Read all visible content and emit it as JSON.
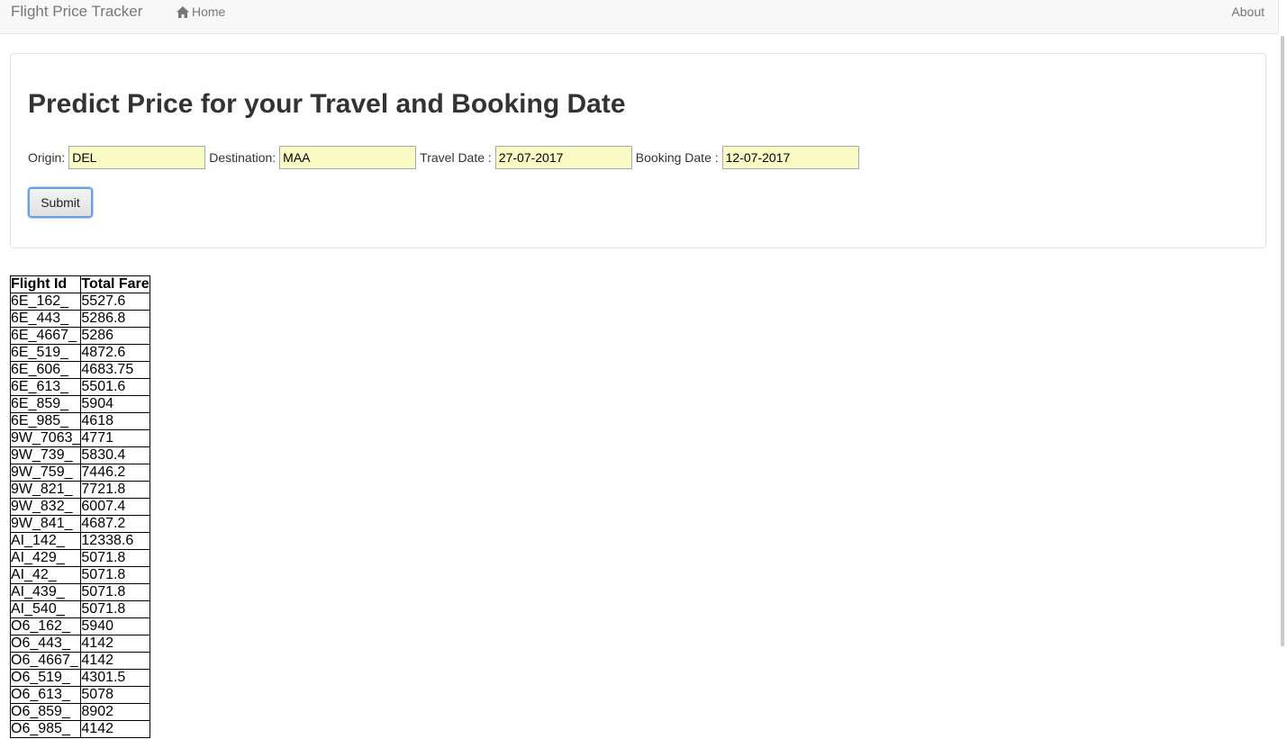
{
  "navbar": {
    "brand": "Flight Price Tracker",
    "home_label": "Home",
    "home_icon": "home-icon",
    "about_label": "About"
  },
  "form": {
    "heading": "Predict Price for your Travel and Booking Date",
    "origin_label": "Origin:",
    "origin_value": "DEL",
    "destination_label": "Destination:",
    "destination_value": "MAA",
    "travel_date_label": "Travel Date :",
    "travel_date_value": "27-07-2017",
    "booking_date_label": "Booking Date :",
    "booking_date_value": "12-07-2017",
    "submit_label": "Submit",
    "input_bg_color": "#fafac4",
    "focus_color": "#6aa0e6"
  },
  "results": {
    "columns": [
      "Flight Id",
      "Total Fare"
    ],
    "rows": [
      [
        "6E_162_",
        "5527.6"
      ],
      [
        "6E_443_",
        "5286.8"
      ],
      [
        "6E_4667_",
        "5286"
      ],
      [
        "6E_519_",
        "4872.6"
      ],
      [
        "6E_606_",
        "4683.75"
      ],
      [
        "6E_613_",
        "5501.6"
      ],
      [
        "6E_859_",
        "5904"
      ],
      [
        "6E_985_",
        "4618"
      ],
      [
        "9W_7063_",
        "4771"
      ],
      [
        "9W_739_",
        "5830.4"
      ],
      [
        "9W_759_",
        "7446.2"
      ],
      [
        "9W_821_",
        "7721.8"
      ],
      [
        "9W_832_",
        "6007.4"
      ],
      [
        "9W_841_",
        "4687.2"
      ],
      [
        "AI_142_",
        "12338.6"
      ],
      [
        "AI_429_",
        "5071.8"
      ],
      [
        "AI_42_",
        "5071.8"
      ],
      [
        "AI_439_",
        "5071.8"
      ],
      [
        "AI_540_",
        "5071.8"
      ],
      [
        "O6_162_",
        "5940"
      ],
      [
        "O6_443_",
        "4142"
      ],
      [
        "O6_4667_",
        "4142"
      ],
      [
        "O6_519_",
        "4301.5"
      ],
      [
        "O6_613_",
        "5078"
      ],
      [
        "O6_859_",
        "8902"
      ],
      [
        "O6_985_",
        "4142"
      ]
    ]
  }
}
